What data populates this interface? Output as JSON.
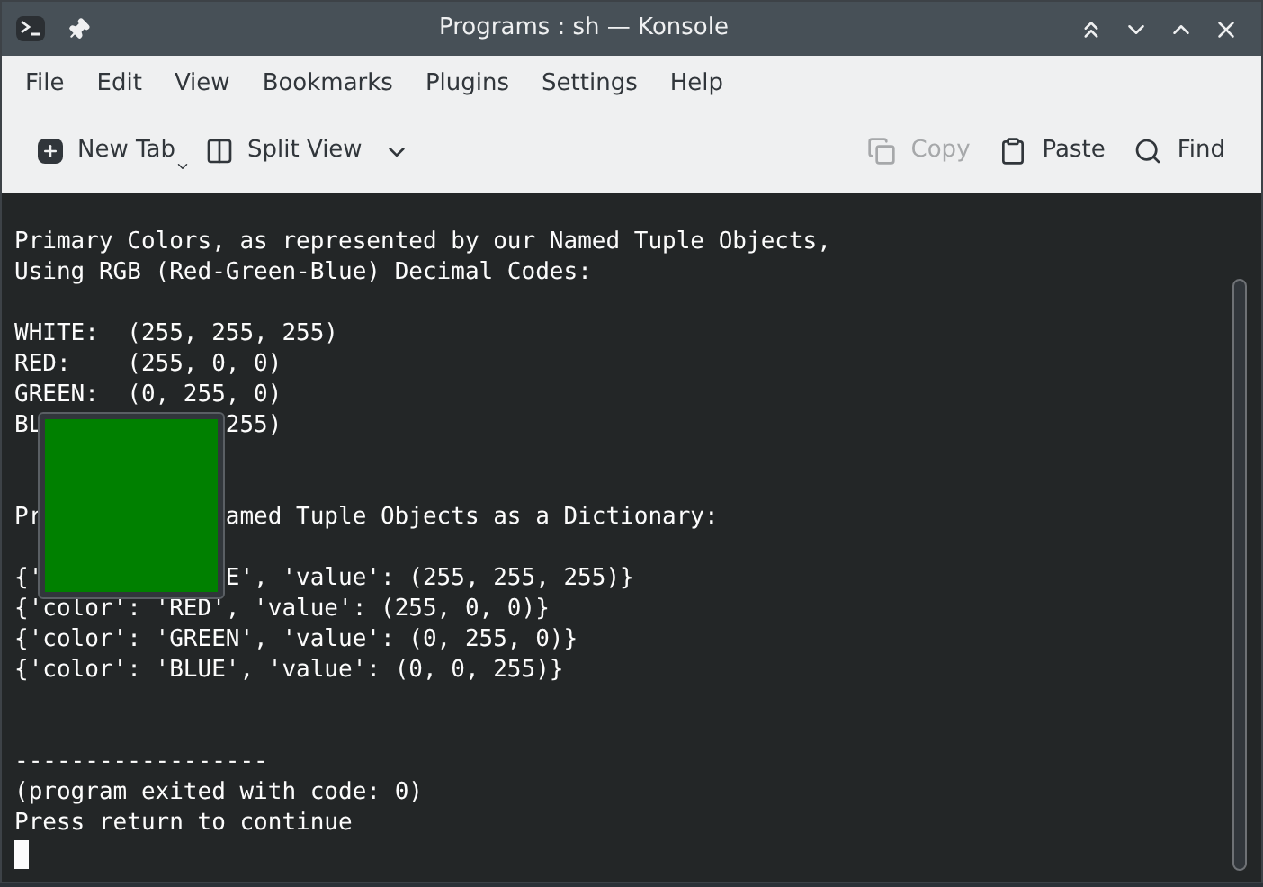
{
  "window": {
    "title": "Programs : sh — Konsole"
  },
  "menu": [
    "File",
    "Edit",
    "View",
    "Bookmarks",
    "Plugins",
    "Settings",
    "Help"
  ],
  "toolbar": {
    "left": [
      {
        "kind": "new-tab",
        "label": "New Tab",
        "disabled": false
      },
      {
        "kind": "split",
        "label": "Split View",
        "disabled": false
      }
    ],
    "right": [
      {
        "kind": "copy",
        "label": "Copy",
        "disabled": true
      },
      {
        "kind": "paste",
        "label": "Paste",
        "disabled": false
      },
      {
        "kind": "find",
        "label": "Find",
        "disabled": false
      }
    ]
  },
  "terminal": {
    "lines": [
      {
        "kind": "blank"
      },
      {
        "kind": "text",
        "segments": [
          "Primary Colors, as represented by our Named Tuple Objects,"
        ]
      },
      {
        "kind": "text",
        "segments": [
          "Using RGB (Red-Green-Blue) Decimal Codes:"
        ]
      },
      {
        "kind": "blank"
      },
      {
        "kind": "text",
        "segments": [
          "WHITE:  (255, 255, 255)"
        ]
      },
      {
        "kind": "text",
        "segments": [
          "RED:    (255, 0, 0)"
        ]
      },
      {
        "kind": "text",
        "segments": [
          "GREEN:  (0, 255, 0)"
        ]
      },
      {
        "kind": "text",
        "segments": [
          "BL",
          "255)"
        ]
      },
      {
        "kind": "blank"
      },
      {
        "kind": "blank"
      },
      {
        "kind": "text",
        "segments": [
          "Pr",
          "amed Tuple Objects as a Dictionary:"
        ]
      },
      {
        "kind": "blank"
      },
      {
        "kind": "text",
        "segments": [
          "{'",
          "E', 'value': (255, 255, 255)}"
        ]
      },
      {
        "kind": "text",
        "segments": [
          "{'color': 'RED', 'value': (255, 0, 0)}"
        ]
      },
      {
        "kind": "text",
        "segments": [
          "{'color': 'GREEN', 'value': (0, 255, 0)}"
        ]
      },
      {
        "kind": "text",
        "segments": [
          "{'color': 'BLUE', 'value': (0, 0, 255)}"
        ]
      },
      {
        "kind": "blank"
      },
      {
        "kind": "blank"
      },
      {
        "kind": "text",
        "segments": [
          "------------------"
        ]
      },
      {
        "kind": "text",
        "segments": [
          "(program exited with code: 0)"
        ]
      },
      {
        "kind": "text",
        "segments": [
          "Press return to continue"
        ]
      },
      {
        "kind": "cursor"
      }
    ],
    "color_popup": {
      "color": "#008000"
    }
  }
}
